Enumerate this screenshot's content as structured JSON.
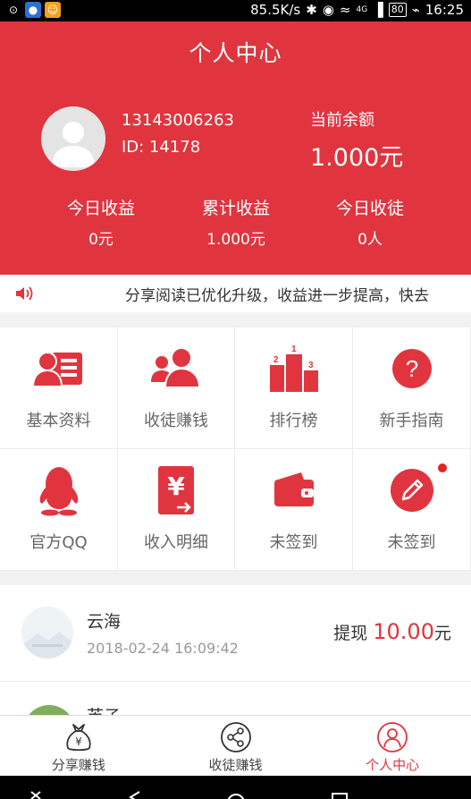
{
  "status_bar": {
    "net_speed": "85.5K/s",
    "network": "4G",
    "battery": "80",
    "time": "16:25"
  },
  "header": {
    "title": "个人中心",
    "phone": "13143006263",
    "user_id": "ID: 14178",
    "balance_label": "当前余额",
    "balance_value": "1.000元",
    "stats": [
      {
        "label": "今日收益",
        "value": "0元"
      },
      {
        "label": "累计收益",
        "value": "1.000元"
      },
      {
        "label": "今日收徒",
        "value": "0人"
      }
    ]
  },
  "notice": {
    "text": "分享阅读已优化升级，收益进一步提高，快去"
  },
  "menu": {
    "items": [
      {
        "label": "基本资料",
        "icon": "profile-card-icon"
      },
      {
        "label": "收徒赚钱",
        "icon": "users-icon"
      },
      {
        "label": "排行榜",
        "icon": "podium-icon"
      },
      {
        "label": "新手指南",
        "icon": "help-icon"
      },
      {
        "label": "官方QQ",
        "icon": "qq-icon"
      },
      {
        "label": "收入明细",
        "icon": "yuan-receipt-icon"
      },
      {
        "label": "未签到",
        "icon": "wallet-icon"
      },
      {
        "label": "未签到",
        "icon": "pencil-icon"
      }
    ]
  },
  "records": [
    {
      "name": "云海",
      "time": "2018-02-24 16:09:42",
      "prefix": "提现",
      "amount": "10.00",
      "unit": "元"
    },
    {
      "name": "芙子"
    }
  ],
  "tabs": [
    {
      "label": "分享赚钱",
      "icon": "money-bag-icon"
    },
    {
      "label": "收徒赚钱",
      "icon": "share-icon"
    },
    {
      "label": "个人中心",
      "icon": "person-icon"
    }
  ],
  "colors": {
    "brand": "#e0353f",
    "badge": "#e82020"
  }
}
